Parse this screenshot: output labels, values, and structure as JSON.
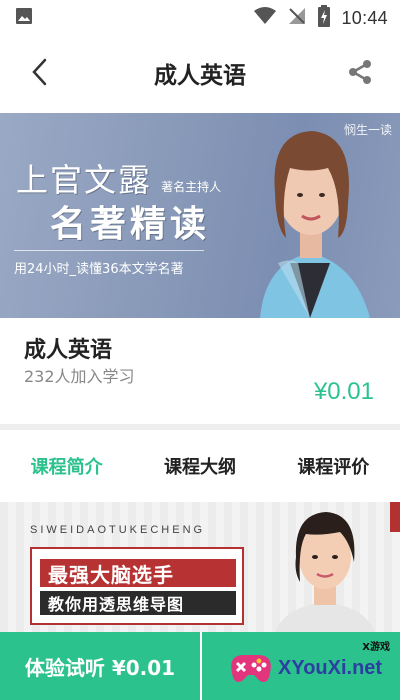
{
  "status_bar": {
    "time": "10:44"
  },
  "header": {
    "title": "成人英语"
  },
  "hero": {
    "name": "上官文露",
    "role": "著名主持人",
    "headline": "名著精读",
    "subtitle": "用24小时_读懂36本文学名著",
    "brand": "悯生一读"
  },
  "course": {
    "title": "成人英语",
    "learners": "232人加入学习",
    "price": "¥0.01"
  },
  "tabs": [
    {
      "label": "课程简介",
      "active": true
    },
    {
      "label": "课程大纲",
      "active": false
    },
    {
      "label": "课程评价",
      "active": false
    }
  ],
  "content_banner": {
    "tag": "SIWEIDAOTUKECHENG",
    "line1": "最强大脑选手",
    "line2": "教你用透思维导图"
  },
  "bottom_bar": {
    "trial_label": "体验试听 ¥0.01"
  },
  "watermark": {
    "text": "XYouXi.net",
    "cn": "X游戏"
  },
  "colors": {
    "accent": "#2cc28e",
    "price": "#2cc28e"
  }
}
